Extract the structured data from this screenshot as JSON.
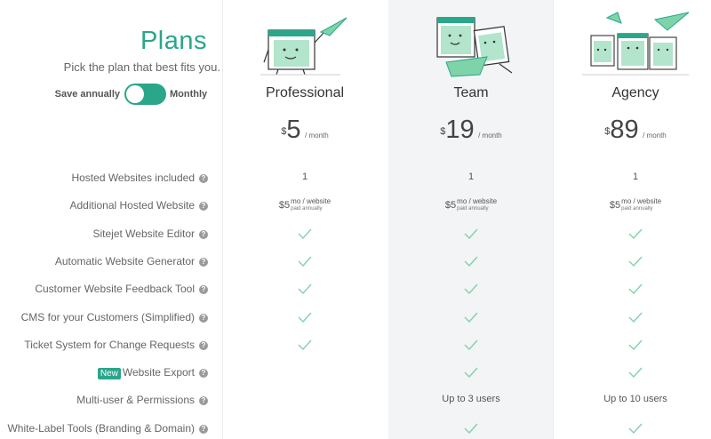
{
  "header": {
    "title": "Plans",
    "subtitle": "Pick the plan that best fits you.",
    "billing_toggle": {
      "left_label": "Save annually",
      "right_label": "Monthly",
      "state": "monthly"
    }
  },
  "plans": [
    {
      "name": "Professional",
      "currency": "$",
      "amount": "5",
      "period": "/ month"
    },
    {
      "name": "Team",
      "currency": "$",
      "amount": "19",
      "period": "/ month"
    },
    {
      "name": "Agency",
      "currency": "$",
      "amount": "89",
      "period": "/ month"
    }
  ],
  "features": [
    {
      "label": "Hosted Websites included",
      "badge": "",
      "values": [
        "1",
        "1",
        "1"
      ]
    },
    {
      "label": "Additional Hosted Website",
      "badge": "",
      "values": [
        "$5 mo / website paid annually",
        "$5 mo / website paid annually",
        "$5 mo / website paid annually"
      ]
    },
    {
      "label": "Sitejet Website Editor",
      "badge": "",
      "values": [
        "check",
        "check",
        "check"
      ]
    },
    {
      "label": "Automatic Website Generator",
      "badge": "",
      "values": [
        "check",
        "check",
        "check"
      ]
    },
    {
      "label": "Customer Website Feedback Tool",
      "badge": "",
      "values": [
        "check",
        "check",
        "check"
      ]
    },
    {
      "label": "CMS for your Customers (Simplified)",
      "badge": "",
      "values": [
        "check",
        "check",
        "check"
      ]
    },
    {
      "label": "Ticket System for Change Requests",
      "badge": "",
      "values": [
        "check",
        "check",
        "check"
      ]
    },
    {
      "label": "Website Export",
      "badge": "New",
      "values": [
        "",
        "check",
        "check"
      ]
    },
    {
      "label": "Multi-user & Permissions",
      "badge": "",
      "values": [
        "",
        "Up to 3 users",
        "Up to 10 users"
      ]
    },
    {
      "label": "White-Label Tools (Branding & Domain)",
      "badge": "",
      "values": [
        "",
        "check",
        "check"
      ]
    }
  ],
  "extra_price": {
    "currency": "$",
    "amount": "5",
    "unit": "mo / website",
    "note": "paid annually"
  },
  "icons": {
    "help": "question-circle-icon",
    "check": "checkmark-icon",
    "illustration": "paper-plane-mascot-illustration"
  },
  "colors": {
    "accent": "#2aa68a",
    "check": "#7fd3a8",
    "team_bg": "#f2f4f5"
  }
}
